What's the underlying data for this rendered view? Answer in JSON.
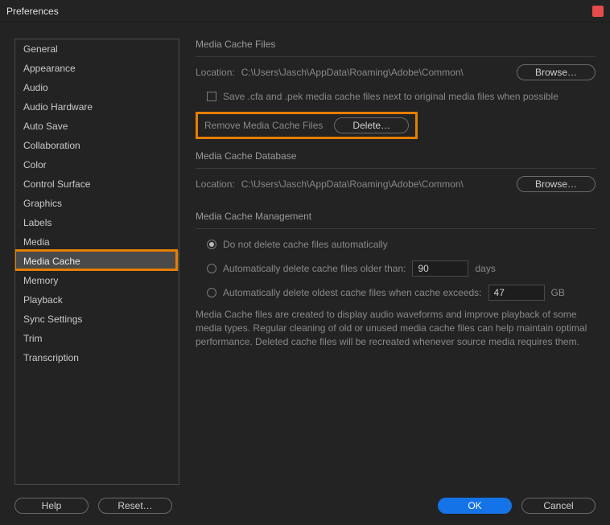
{
  "window": {
    "title": "Preferences"
  },
  "sidebar": {
    "items": [
      {
        "label": "General"
      },
      {
        "label": "Appearance"
      },
      {
        "label": "Audio"
      },
      {
        "label": "Audio Hardware"
      },
      {
        "label": "Auto Save"
      },
      {
        "label": "Collaboration"
      },
      {
        "label": "Color"
      },
      {
        "label": "Control Surface"
      },
      {
        "label": "Graphics"
      },
      {
        "label": "Labels"
      },
      {
        "label": "Media"
      },
      {
        "label": "Media Cache",
        "selected": true
      },
      {
        "label": "Memory"
      },
      {
        "label": "Playback"
      },
      {
        "label": "Sync Settings"
      },
      {
        "label": "Trim"
      },
      {
        "label": "Transcription"
      }
    ]
  },
  "mediaCacheFiles": {
    "title": "Media Cache Files",
    "locationLabel": "Location:",
    "locationPath": "C:\\Users\\Jasch\\AppData\\Roaming\\Adobe\\Common\\",
    "browse": "Browse…",
    "saveNextToLabel": "Save .cfa and .pek media cache files next to original media files when possible",
    "removeLabel": "Remove Media Cache Files",
    "delete": "Delete…"
  },
  "mediaCacheDatabase": {
    "title": "Media Cache Database",
    "locationLabel": "Location:",
    "locationPath": "C:\\Users\\Jasch\\AppData\\Roaming\\Adobe\\Common\\",
    "browse": "Browse…"
  },
  "mediaCacheManagement": {
    "title": "Media Cache Management",
    "opt1": "Do not delete cache files automatically",
    "opt2": "Automatically delete cache files older than:",
    "opt2value": "90",
    "opt2unit": "days",
    "opt3": "Automatically delete oldest cache files when cache exceeds:",
    "opt3value": "47",
    "opt3unit": "GB",
    "description": "Media Cache files are created to display audio waveforms and improve playback of some media types.  Regular cleaning of old or unused media cache files can help maintain optimal performance. Deleted cache files will be recreated whenever source media requires them."
  },
  "footer": {
    "help": "Help",
    "reset": "Reset…",
    "ok": "OK",
    "cancel": "Cancel"
  },
  "colors": {
    "highlight": "#e67e00"
  }
}
